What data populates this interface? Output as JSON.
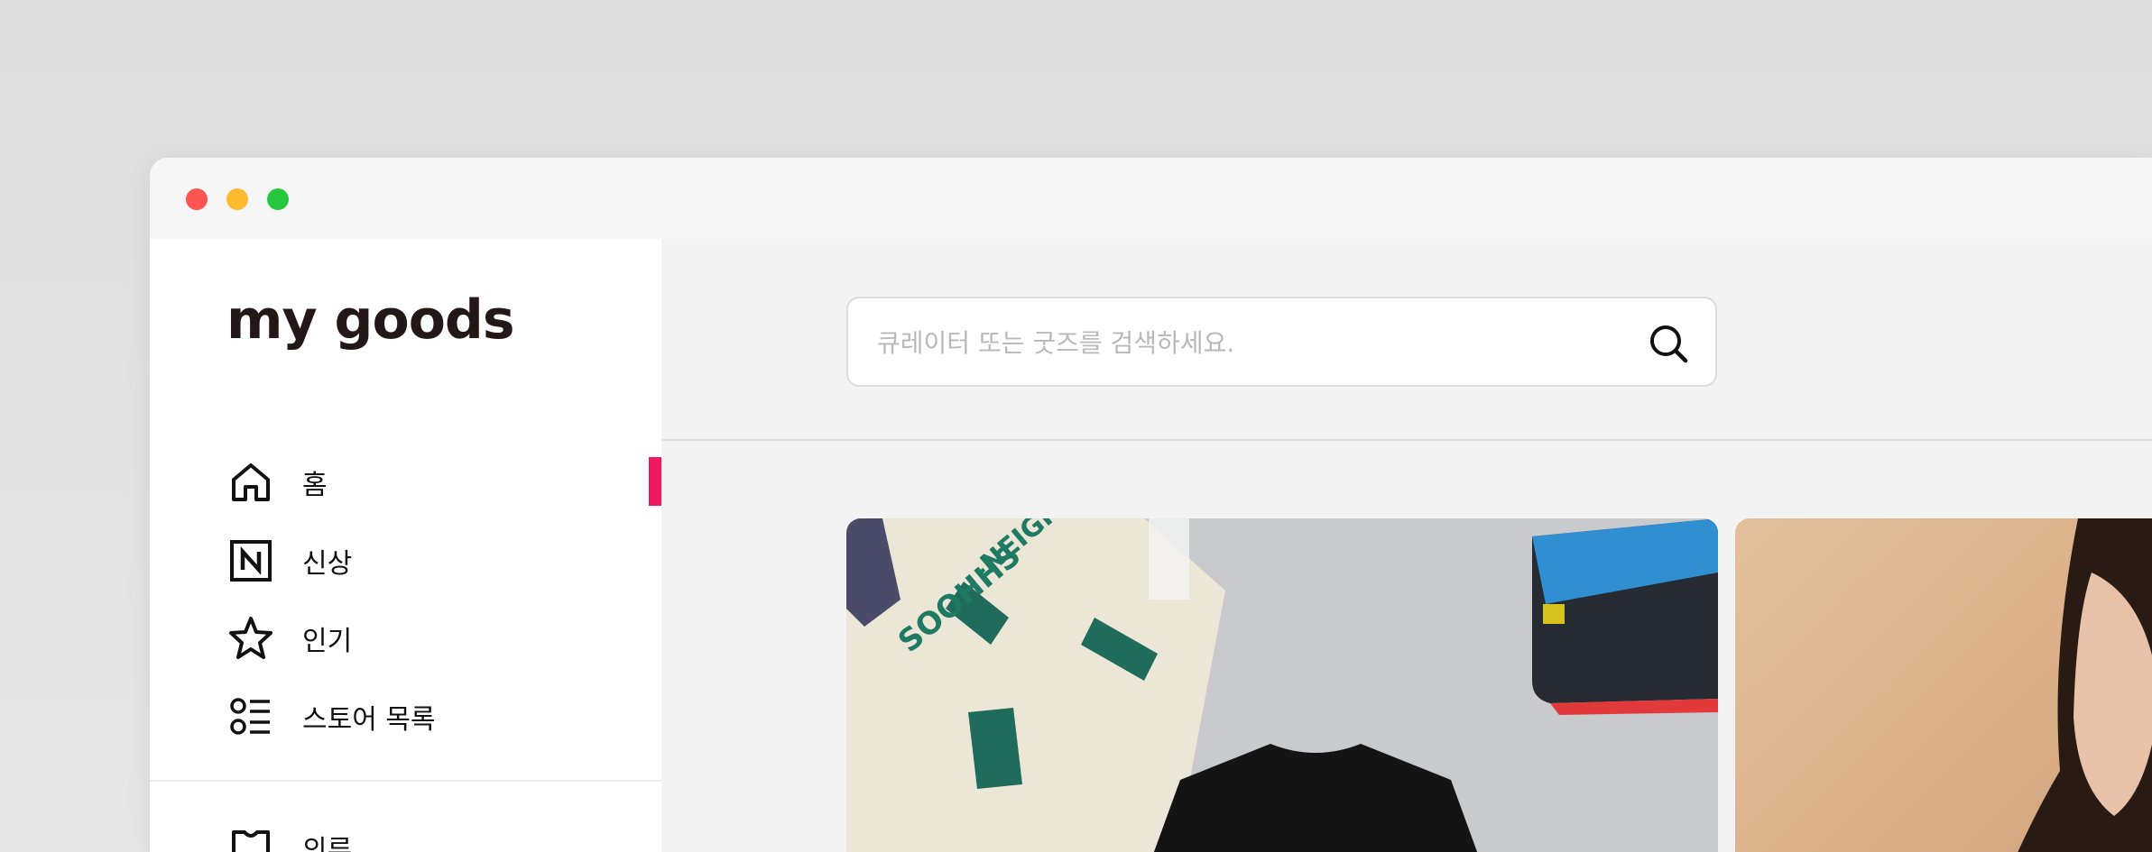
{
  "app": {
    "logo_text": "my goods"
  },
  "search": {
    "placeholder": "큐레이터 또는 굿즈를 검색하세요."
  },
  "sidebar": {
    "items": [
      {
        "label": "홈",
        "icon": "home-icon"
      },
      {
        "label": "신상",
        "icon": "new-badge-icon"
      },
      {
        "label": "인기",
        "icon": "star-icon"
      },
      {
        "label": "스토어 목록",
        "icon": "store-list-icon"
      }
    ],
    "secondary_items": [
      {
        "label": "의류",
        "icon": "shirt-icon"
      }
    ]
  },
  "colors": {
    "accent": "#f0185e",
    "close": "#ff5550",
    "minimize": "#febb2f",
    "maximize": "#25c83e"
  }
}
